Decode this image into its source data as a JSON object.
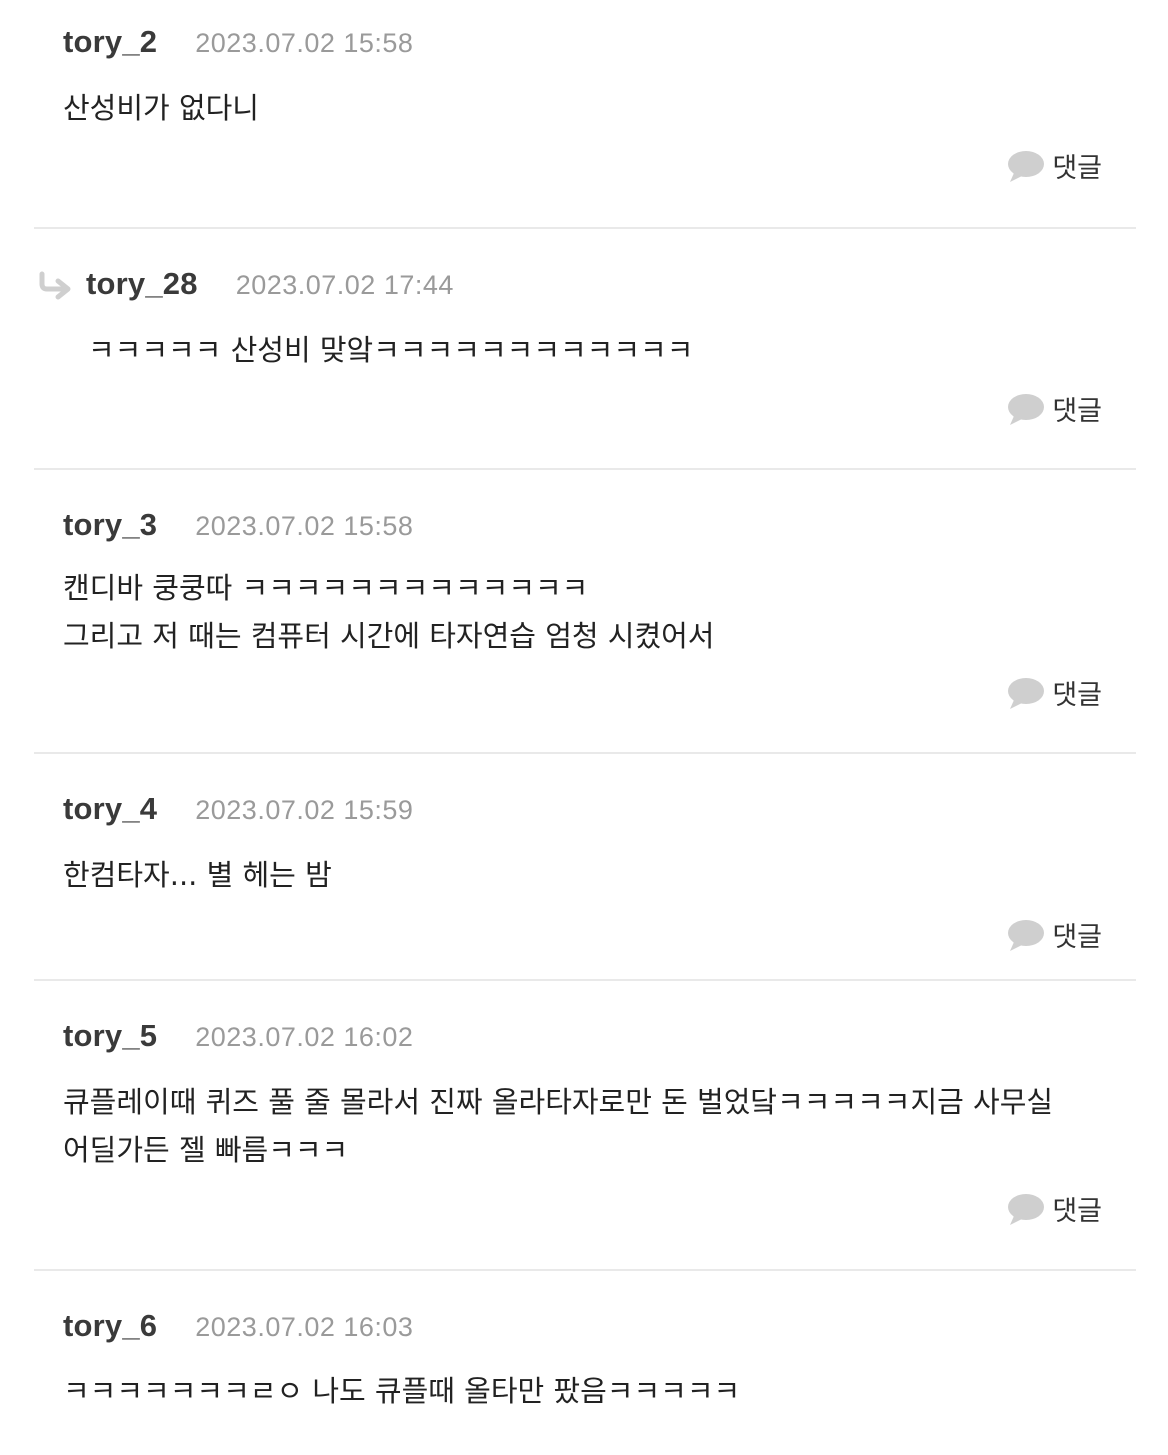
{
  "comments": [
    {
      "nickname": "tory_2",
      "date": "2023.07.02 15:58",
      "lines": [
        "산성비가 없다니"
      ],
      "reply_label": "댓글"
    },
    {
      "nickname": "tory_28",
      "date": "2023.07.02 17:44",
      "lines": [
        "ㅋㅋㅋㅋㅋ 산성비 맞앜ㅋㅋㅋㅋㅋㅋㅋㅋㅋㅋㅋㅋ"
      ],
      "reply_label": "댓글"
    },
    {
      "nickname": "tory_3",
      "date": "2023.07.02 15:58",
      "lines": [
        "캔디바 쿵쿵따 ㅋㅋㅋㅋㅋㅋㅋㅋㅋㅋㅋㅋㅋ",
        "그리고 저 때는 컴퓨터 시간에 타자연습 엄청 시켰어서"
      ],
      "reply_label": "댓글"
    },
    {
      "nickname": "tory_4",
      "date": "2023.07.02 15:59",
      "lines": [
        "한컴타자... 별 헤는 밤"
      ],
      "reply_label": "댓글"
    },
    {
      "nickname": "tory_5",
      "date": "2023.07.02 16:02",
      "lines": [
        "큐플레이때 퀴즈 풀 줄 몰라서 진짜 올라타자로만 돈 벌었닼ㅋㅋㅋㅋㅋ지금 사무실",
        "어딜가든 젤 빠름ㅋㅋㅋ"
      ],
      "reply_label": "댓글"
    },
    {
      "nickname": "tory_6",
      "date": "2023.07.02 16:03",
      "lines": [
        "ㅋㅋㅋㅋㅋㅋㅋㄹㅇ 나도 큐플때 올타만 팠음ㅋㅋㅋㅋㅋ"
      ]
    }
  ],
  "icons": {
    "reply_bubble": "speech-bubble-icon",
    "reply_arrow": "reply-arrow-icon"
  },
  "colors": {
    "nickname": "#3a3a3a",
    "date": "#9a9a9a",
    "divider": "#e9e9e9",
    "bubble": "#cfcfcf"
  }
}
